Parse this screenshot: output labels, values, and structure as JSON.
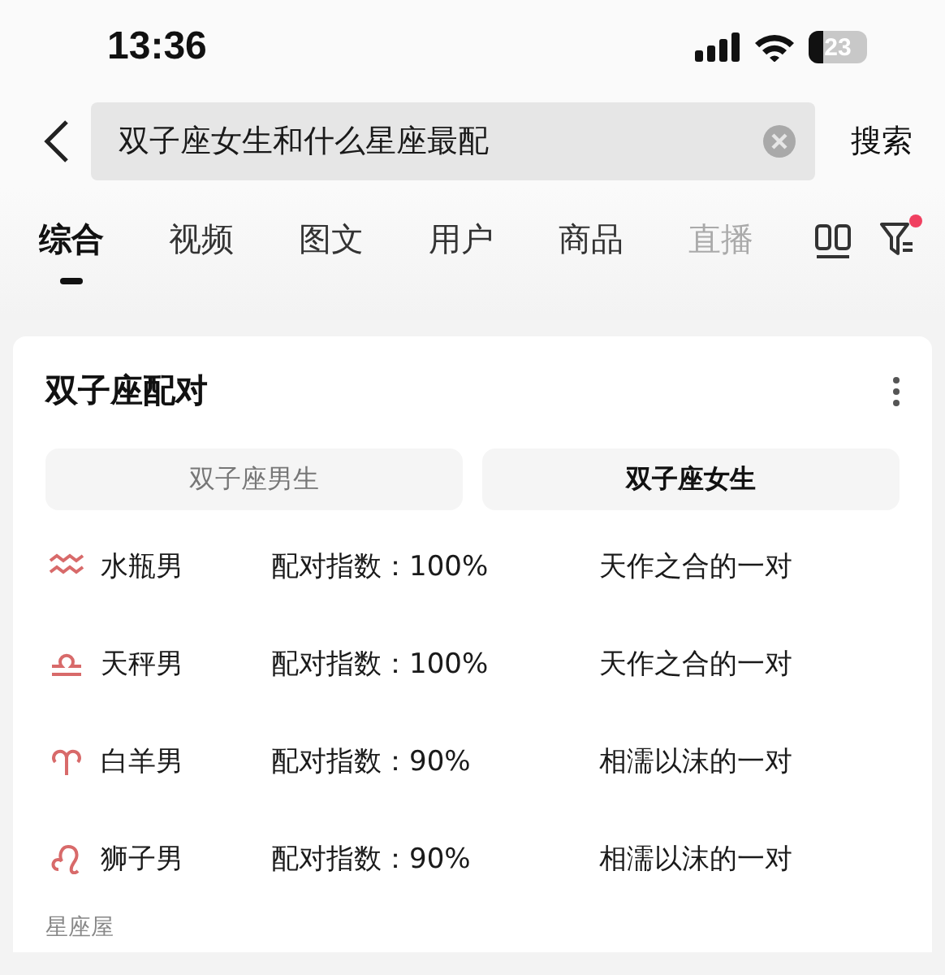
{
  "status_bar": {
    "time": "13:36",
    "battery": "23"
  },
  "search": {
    "value": "双子座女生和什么星座最配",
    "button": "搜索"
  },
  "tabs": [
    {
      "label": "综合",
      "selected": true
    },
    {
      "label": "视频",
      "selected": false
    },
    {
      "label": "图文",
      "selected": false
    },
    {
      "label": "用户",
      "selected": false
    },
    {
      "label": "商品",
      "selected": false
    },
    {
      "label": "直播",
      "selected": false
    }
  ],
  "filter": {
    "has_notification": true
  },
  "card": {
    "title": "双子座配对",
    "segments": [
      {
        "label": "双子座男生",
        "selected": false
      },
      {
        "label": "双子座女生",
        "selected": true
      }
    ],
    "rows": [
      {
        "kind": "aquarius",
        "name": "水瓶男",
        "score": "配对指数：100%",
        "comment": "天作之合的一对"
      },
      {
        "kind": "libra",
        "name": "天秤男",
        "score": "配对指数：100%",
        "comment": "天作之合的一对"
      },
      {
        "kind": "aries",
        "name": "白羊男",
        "score": "配对指数：90%",
        "comment": "相濡以沫的一对"
      },
      {
        "kind": "leo",
        "name": "狮子男",
        "score": "配对指数：90%",
        "comment": "相濡以沫的一对"
      }
    ],
    "source": "星座屋"
  }
}
